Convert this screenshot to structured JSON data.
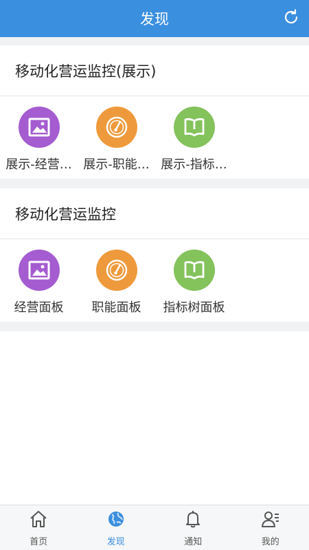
{
  "header": {
    "title": "发现"
  },
  "colors": {
    "header_bg": "#3b8fdf",
    "purple": "#a45cd0",
    "orange": "#ee9a3c",
    "green": "#84c25c",
    "active_nav": "#3b8fdf"
  },
  "sections": [
    {
      "title": "移动化营运监控(展示)",
      "items": [
        {
          "label": "展示-经营…",
          "icon": "image-icon"
        },
        {
          "label": "展示-职能…",
          "icon": "gauge-icon"
        },
        {
          "label": "展示-指标…",
          "icon": "book-icon"
        }
      ]
    },
    {
      "title": "移动化营运监控",
      "items": [
        {
          "label": "经营面板",
          "icon": "image-icon"
        },
        {
          "label": "职能面板",
          "icon": "gauge-icon"
        },
        {
          "label": "指标树面板",
          "icon": "book-icon"
        }
      ]
    }
  ],
  "nav": {
    "items": [
      {
        "label": "首页",
        "icon": "home-icon"
      },
      {
        "label": "发现",
        "icon": "globe-icon",
        "active": true
      },
      {
        "label": "通知",
        "icon": "bell-icon"
      },
      {
        "label": "我的",
        "icon": "user-icon"
      }
    ]
  }
}
